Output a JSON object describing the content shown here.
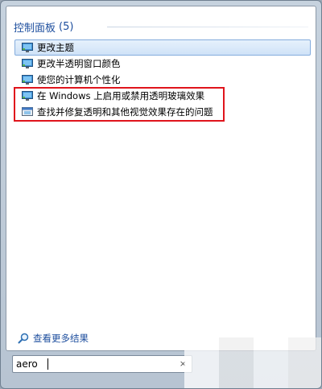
{
  "group": {
    "title": "控制面板",
    "count": "(5)"
  },
  "results": [
    {
      "label": "更改主题",
      "icon": "display-settings-icon"
    },
    {
      "label": "更改半透明窗口颜色",
      "icon": "display-settings-icon"
    },
    {
      "label": "使您的计算机个性化",
      "icon": "display-settings-icon"
    },
    {
      "label": "在 Windows 上启用或禁用透明玻璃效果",
      "icon": "display-settings-icon"
    },
    {
      "label": "查找并修复透明和其他视觉效果存在的问题",
      "icon": "troubleshoot-icon"
    }
  ],
  "more_results": {
    "label": "查看更多结果",
    "icon": "magnifier-icon"
  },
  "search": {
    "value": "aero",
    "clear": "×"
  },
  "colors": {
    "highlight_border": "#e0141c",
    "link": "#1d4e9e"
  }
}
